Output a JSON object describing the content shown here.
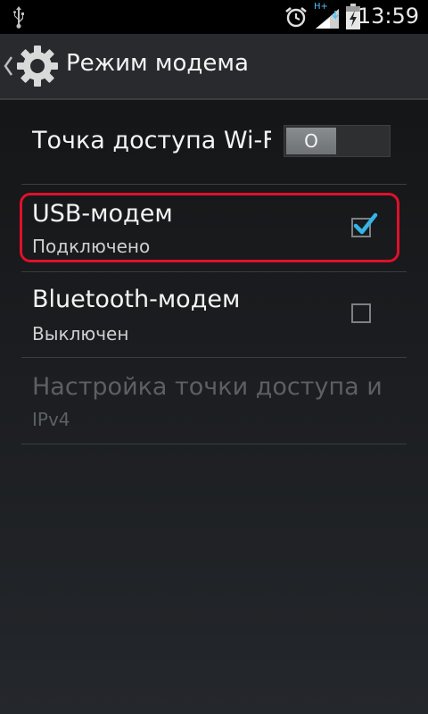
{
  "status_bar": {
    "network_type": "H+",
    "time": "13:59",
    "icons": [
      "usb-icon",
      "alarm-icon",
      "signal-icon",
      "battery-icon"
    ]
  },
  "action_bar": {
    "title": "Режим модема",
    "icon": "gear-icon"
  },
  "settings": {
    "wifi_hotspot": {
      "title": "Точка доступа Wi-Fi",
      "toggle_label": "O",
      "enabled": false
    },
    "usb_tethering": {
      "title": "USB-модем",
      "subtitle": "Подключено",
      "checked": true,
      "highlight_color": "#e0102a"
    },
    "bluetooth_tethering": {
      "title": "Bluetooth-модем",
      "subtitle": "Выключен",
      "checked": false
    },
    "hotspot_config": {
      "title": "Настройка точки доступа и",
      "subtitle": "IPv4",
      "enabled": false
    }
  },
  "colors": {
    "accent": "#33b5e5",
    "highlight": "#e0102a",
    "disabled_text": "#5d6063"
  }
}
